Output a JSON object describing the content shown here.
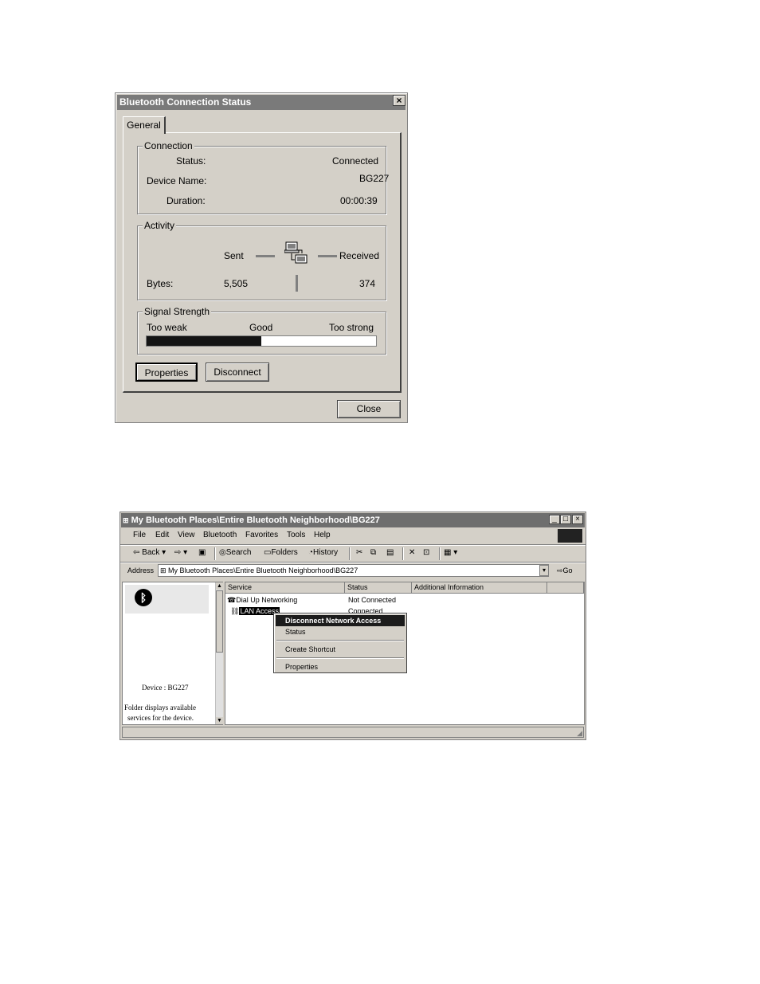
{
  "dialog": {
    "title": "Bluetooth Connection Status",
    "close_x": "×",
    "tab": "General",
    "connection": {
      "legend": "Connection",
      "status_label": "Status:",
      "status_value": "Connected",
      "device_label": "Device Name:",
      "device_value": "BG227",
      "duration_label": "Duration:",
      "duration_value": "00:00:39"
    },
    "activity": {
      "legend": "Activity",
      "sent": "Sent",
      "received": "Received",
      "bytes_label": "Bytes:",
      "bytes_sent": "5,505",
      "bytes_received": "374"
    },
    "signal": {
      "legend": "Signal Strength",
      "weak": "Too weak",
      "good": "Good",
      "strong": "Too strong",
      "level_fraction": 0.5
    },
    "buttons": {
      "properties": "Properties",
      "disconnect": "Disconnect",
      "close": "Close"
    }
  },
  "explorer": {
    "title": "My Bluetooth Places\\Entire Bluetooth Neighborhood\\BG227",
    "menu": [
      "File",
      "Edit",
      "View",
      "Bluetooth",
      "Favorites",
      "Tools",
      "Help"
    ],
    "toolbar": {
      "back": "Back",
      "search": "Search",
      "folders": "Folders",
      "history": "History"
    },
    "address_label": "Address",
    "address_value": "My Bluetooth Places\\Entire Bluetooth Neighborhood\\BG227",
    "go": "Go",
    "left_pane": {
      "device": "Device : BG227",
      "desc_line1": "Folder displays available",
      "desc_line2": "services for the device."
    },
    "columns": [
      "Service",
      "Status",
      "Additional Information"
    ],
    "rows": [
      {
        "service": "Dial Up Networking",
        "status": "Not Connected"
      },
      {
        "service": "LAN Access",
        "status": "Connected"
      }
    ],
    "context_menu": [
      "Disconnect Network Access",
      "Status",
      "Create Shortcut",
      "Properties"
    ]
  }
}
